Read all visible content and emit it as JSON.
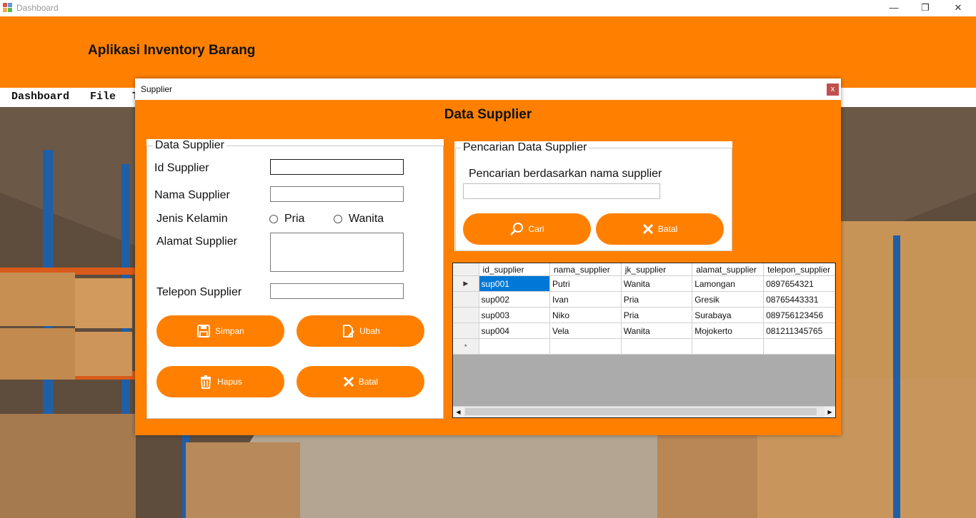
{
  "window": {
    "title": "Dashboard",
    "controls": [
      "—",
      "❐",
      "✕"
    ]
  },
  "header": {
    "app_title": "Aplikasi Inventory Barang"
  },
  "menu": {
    "items": [
      "Dashboard",
      "File",
      "T"
    ]
  },
  "dialog": {
    "title": "Supplier",
    "close_label": "x",
    "heading": "Data Supplier",
    "form": {
      "legend": "Data Supplier",
      "id_label": "Id Supplier",
      "id_value": "",
      "nama_label": "Nama Supplier",
      "nama_value": "",
      "jk_label": "Jenis Kelamin",
      "radio_pria": "Pria",
      "radio_wanita": "Wanita",
      "alamat_label": "Alamat Supplier",
      "alamat_value": "",
      "telepon_label": "Telepon Supplier",
      "telepon_value": "",
      "buttons": {
        "simpan": "Simpan",
        "ubah": "Ubah",
        "hapus": "Hapus",
        "batal": "Batal"
      }
    },
    "search": {
      "legend": "Pencarian Data Supplier",
      "label": "Pencarian berdasarkan nama supplier",
      "value": "",
      "cari": "Cari",
      "batal": "Batal"
    },
    "grid": {
      "columns": [
        "id_supplier",
        "nama_supplier",
        "jk_supplier",
        "alamat_supplier",
        "telepon_supplier"
      ],
      "rows": [
        [
          "sup001",
          "Putri",
          "Wanita",
          "Lamongan",
          "0897654321"
        ],
        [
          "sup002",
          "Ivan",
          "Pria",
          "Gresik",
          "08765443331"
        ],
        [
          "sup003",
          "Niko",
          "Pria",
          "Surabaya",
          "089756123456"
        ],
        [
          "sup004",
          "Vela",
          "Wanita",
          "Mojokerto",
          "081211345765"
        ]
      ],
      "row_marker_current": "▶",
      "row_marker_new": "*"
    }
  },
  "colors": {
    "accent": "#ff8000",
    "selection": "#0078d7",
    "close": "#c0504d"
  }
}
